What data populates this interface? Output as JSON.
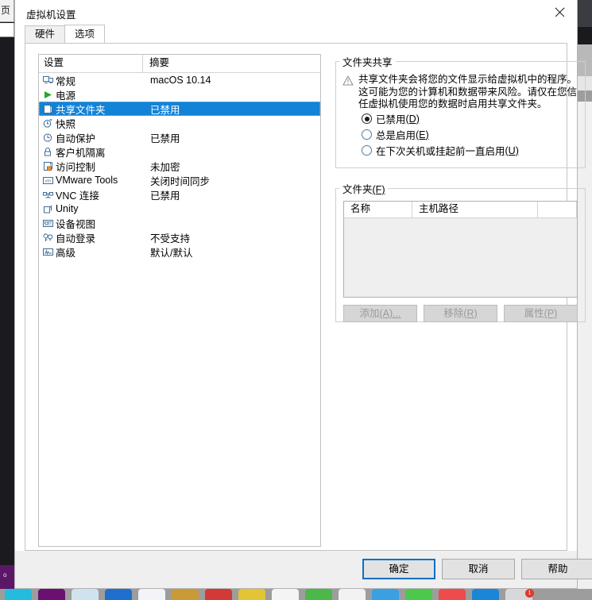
{
  "window": {
    "title": "虚拟机设置",
    "close_label": "×"
  },
  "desktop": {
    "left_chrome_text": "页",
    "left_purple_text": "o"
  },
  "tabs": [
    {
      "id": "hardware",
      "label": "硬件",
      "active": false
    },
    {
      "id": "options",
      "label": "选项",
      "active": true
    }
  ],
  "settings_list": {
    "headers": {
      "name": "设置",
      "summary": "摘要"
    },
    "rows": [
      {
        "icon": "monitor-icon",
        "label": "常规",
        "summary": "macOS 10.14",
        "selected": false
      },
      {
        "icon": "power-play-icon",
        "label": "电源",
        "summary": "",
        "selected": false
      },
      {
        "icon": "shared-folder-icon",
        "label": "共享文件夹",
        "summary": "已禁用",
        "selected": true
      },
      {
        "icon": "snapshot-clock-icon",
        "label": "快照",
        "summary": "",
        "selected": false
      },
      {
        "icon": "autoprotect-icon",
        "label": "自动保护",
        "summary": "已禁用",
        "selected": false
      },
      {
        "icon": "lock-icon",
        "label": "客户机隔离",
        "summary": "",
        "selected": false
      },
      {
        "icon": "access-control-icon",
        "label": "访问控制",
        "summary": "未加密",
        "selected": false
      },
      {
        "icon": "vmware-tools-icon",
        "label": "VMware Tools",
        "summary": "关闭时间同步",
        "selected": false
      },
      {
        "icon": "vnc-icon",
        "label": "VNC 连接",
        "summary": "已禁用",
        "selected": false
      },
      {
        "icon": "unity-icon",
        "label": "Unity",
        "summary": "",
        "selected": false
      },
      {
        "icon": "device-view-icon",
        "label": "设备视图",
        "summary": "",
        "selected": false
      },
      {
        "icon": "autologon-icon",
        "label": "自动登录",
        "summary": "不受支持",
        "selected": false
      },
      {
        "icon": "advanced-icon",
        "label": "高级",
        "summary": "默认/默认",
        "selected": false
      }
    ]
  },
  "folder_sharing": {
    "legend": "文件夹共享",
    "warning_icon": "warning-triangle-icon",
    "warning_text": "共享文件夹会将您的文件显示给虚拟机中的程序。这可能为您的计算机和数据带来风险。请仅在您信任虚拟机使用您的数据时启用共享文件夹。",
    "options": [
      {
        "id": "disabled",
        "label": "已禁用",
        "accel": "(D)",
        "checked": true
      },
      {
        "id": "always",
        "label": "总是启用",
        "accel": "(E)",
        "checked": false
      },
      {
        "id": "until-shutdown",
        "label": "在下次关机或挂起前一直启用",
        "accel": "(U)",
        "checked": false
      }
    ]
  },
  "folders": {
    "legend": "文件夹",
    "legend_accel": "(F)",
    "columns": [
      "名称",
      "主机路径",
      ""
    ],
    "rows": [],
    "buttons": [
      {
        "id": "add",
        "label": "添加",
        "accel": "(A)...",
        "enabled": false
      },
      {
        "id": "remove",
        "label": "移除",
        "accel": "(R)",
        "enabled": false
      },
      {
        "id": "properties",
        "label": "属性",
        "accel": "(P)",
        "enabled": false
      }
    ]
  },
  "footer": {
    "ok": "确定",
    "cancel": "取消",
    "help": "帮助"
  },
  "colors": {
    "selection_blue": "#1283d6",
    "focus_border_blue": "#0d6fc4",
    "dialog_bg": "#ffffff",
    "footer_bg": "#efefef"
  },
  "dock": {
    "icons": [
      {
        "name": "finder",
        "color": "#23bcdf"
      },
      {
        "name": "launchpad",
        "color": "#6b1070"
      },
      {
        "name": "safari",
        "color": "#cfe3ef"
      },
      {
        "name": "browser",
        "color": "#1f6fcf"
      },
      {
        "name": "mail",
        "color": "#f2f4f7"
      },
      {
        "name": "notes",
        "color": "#c99a36"
      },
      {
        "name": "music",
        "color": "#d23a36"
      },
      {
        "name": "reminders",
        "color": "#e2c434"
      },
      {
        "name": "pages",
        "color": "#f4f4f4"
      },
      {
        "name": "numbers",
        "color": "#4db84a"
      },
      {
        "name": "settings",
        "color": "#f2f2f2"
      },
      {
        "name": "messages",
        "color": "#3aa0e2"
      },
      {
        "name": "facetime",
        "color": "#4cc94c"
      },
      {
        "name": "photos",
        "color": "#ef4b4b"
      },
      {
        "name": "appstore",
        "color": "#1b86d8"
      },
      {
        "name": "mailbox",
        "color": "#d8d8d8",
        "badge": "1"
      }
    ]
  }
}
